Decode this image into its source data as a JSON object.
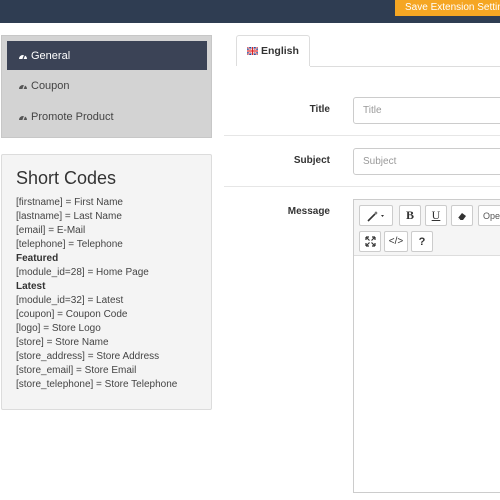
{
  "header": {
    "save_label": "Save Extension Settings"
  },
  "nav": {
    "items": [
      {
        "label": "General",
        "icon": "dashboard-icon",
        "active": true
      },
      {
        "label": "Coupon",
        "icon": "dashboard-icon",
        "active": false
      },
      {
        "label": "Promote Product",
        "icon": "dashboard-icon",
        "active": false
      }
    ]
  },
  "shortcodes": {
    "title": "Short Codes",
    "lines": [
      "[firstname] = First Name",
      "[lastname] = Last Name",
      "[email] = E-Mail",
      "[telephone] = Telephone",
      "Featured",
      "[module_id=28] = Home Page",
      "Latest",
      "[module_id=32] = Latest",
      "[coupon] = Coupon Code",
      "[logo] = Store Logo",
      "[store] = Store Name",
      "[store_address] = Store Address",
      "[store_email] = Store Email",
      "[store_telephone] = Store Telephone"
    ]
  },
  "tabs": {
    "language": "English"
  },
  "form": {
    "title_label": "Title",
    "title_placeholder": "Title",
    "subject_label": "Subject",
    "subject_placeholder": "Subject",
    "message_label": "Message"
  },
  "editor": {
    "toolbar": {
      "bold": "B",
      "underline": "U",
      "font_name": "Ope",
      "codeview": "</>",
      "help": "?"
    }
  },
  "colors": {
    "topbar": "#2f3d52",
    "save_button": "#f5a623",
    "nav_active": "#3b4356",
    "nav_panel": "#d3d3d3"
  }
}
